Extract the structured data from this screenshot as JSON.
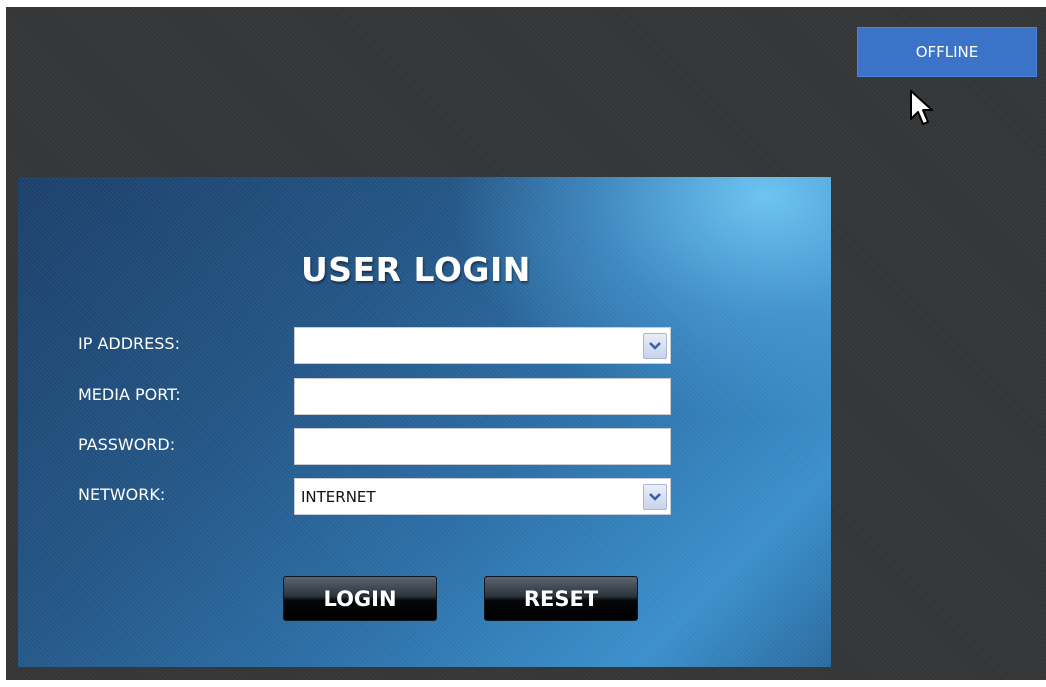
{
  "header": {
    "offline_label": "OFFLINE"
  },
  "login": {
    "title": "USER LOGIN",
    "fields": [
      {
        "label": "IP ADDRESS:",
        "value": "",
        "type": "dropdown"
      },
      {
        "label": "MEDIA PORT:",
        "value": "",
        "type": "text"
      },
      {
        "label": "PASSWORD:",
        "value": "",
        "type": "password"
      },
      {
        "label": "NETWORK:",
        "value": "INTERNET",
        "type": "dropdown"
      }
    ],
    "buttons": {
      "login_label": "LOGIN",
      "reset_label": "RESET"
    }
  },
  "icons": [
    "chevron-down-icon",
    "mouse-pointer-icon"
  ],
  "colors": {
    "background": "#333537",
    "offline_button": "#3a73c8",
    "panel_dark": "#1b3f6a",
    "panel_light": "#6ec8f5"
  }
}
